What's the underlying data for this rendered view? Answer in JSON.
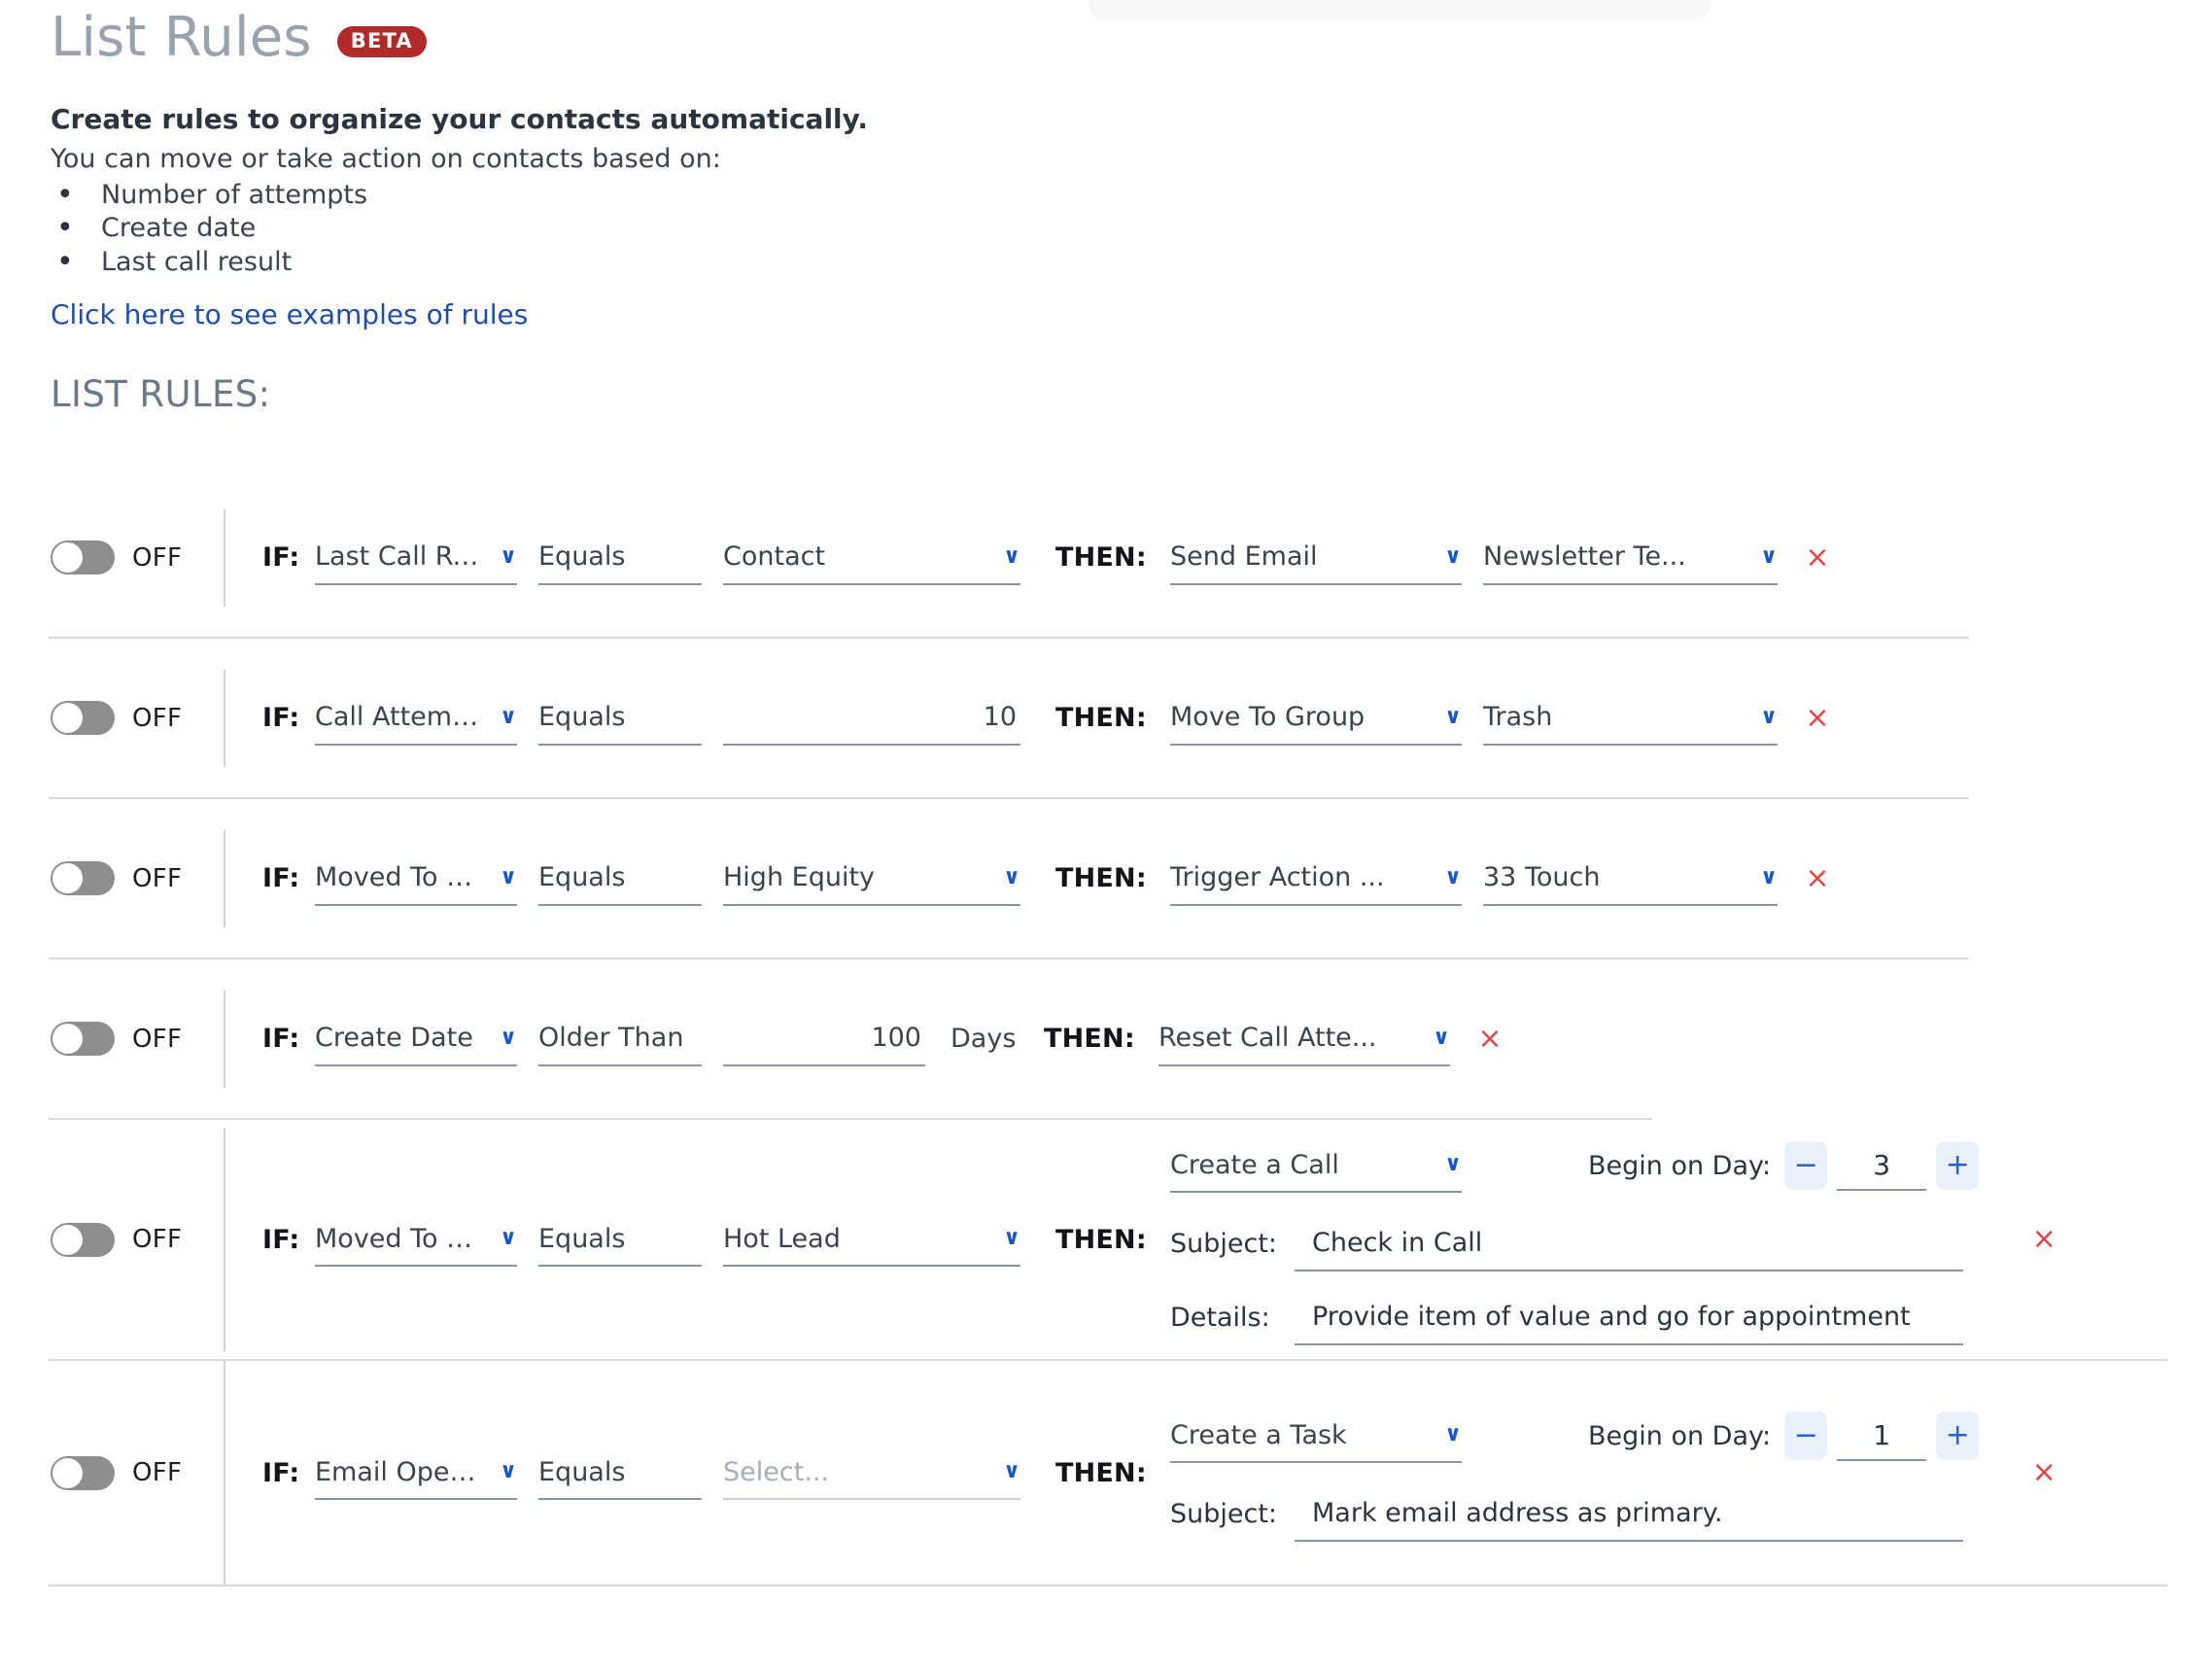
{
  "header": {
    "title": "List Rules",
    "badge": "BETA",
    "lead_bold": "Create rules to organize your contacts automatically.",
    "lead_sub": "You can move or take action on contacts based on:",
    "bullets": [
      "Number of attempts",
      "Create date",
      "Last call result"
    ],
    "examples_link": "Click here to see examples of rules",
    "section_label": "LIST RULES:"
  },
  "labels": {
    "if": "IF:",
    "then": "THEN:",
    "toggle_off": "OFF",
    "days": "Days",
    "begin_on_day": "Begin on Day:",
    "subject": "Subject:",
    "details": "Details:",
    "delete": "×",
    "caret": "∨",
    "minus": "−",
    "plus": "+"
  },
  "colors": {
    "accent_link": "#1d4eab",
    "badge_bg": "#b02a2a",
    "caret_blue": "#1a56c4",
    "delete_red": "#e04747",
    "toggle_off_bg": "#8e8e8e",
    "stepper_bg": "#e9f0fb",
    "underline": "#8b95a1",
    "divider": "#d7d9dc"
  },
  "rules": [
    {
      "enabled_label": "OFF",
      "condition": "Last Call Result",
      "operator": "Equals",
      "value": "Contact",
      "action": "Send Email",
      "action_value": "Newsletter Te..."
    },
    {
      "enabled_label": "OFF",
      "condition": "Call Attempts",
      "operator": "Equals",
      "value": "10",
      "action": "Move To Group",
      "action_value": "Trash"
    },
    {
      "enabled_label": "OFF",
      "condition": "Moved To List",
      "operator": "Equals",
      "value": "High Equity",
      "action": "Trigger Action ...",
      "action_value": "33 Touch"
    },
    {
      "enabled_label": "OFF",
      "condition": "Create Date",
      "operator": "Older Than",
      "value": "100",
      "unit": "Days",
      "action": "Reset Call Atte..."
    },
    {
      "enabled_label": "OFF",
      "condition": "Moved To Group",
      "operator": "Equals",
      "value": "Hot Lead",
      "action": "Create a Call",
      "begin_on_day": "3",
      "subject": "Check in Call",
      "details": "Provide item of value and go for appointment"
    },
    {
      "enabled_label": "OFF",
      "condition": "Email Opened",
      "operator": "Equals",
      "value_placeholder": "Select...",
      "action": "Create a Task",
      "begin_on_day": "1",
      "subject": "Mark email address as primary."
    }
  ]
}
